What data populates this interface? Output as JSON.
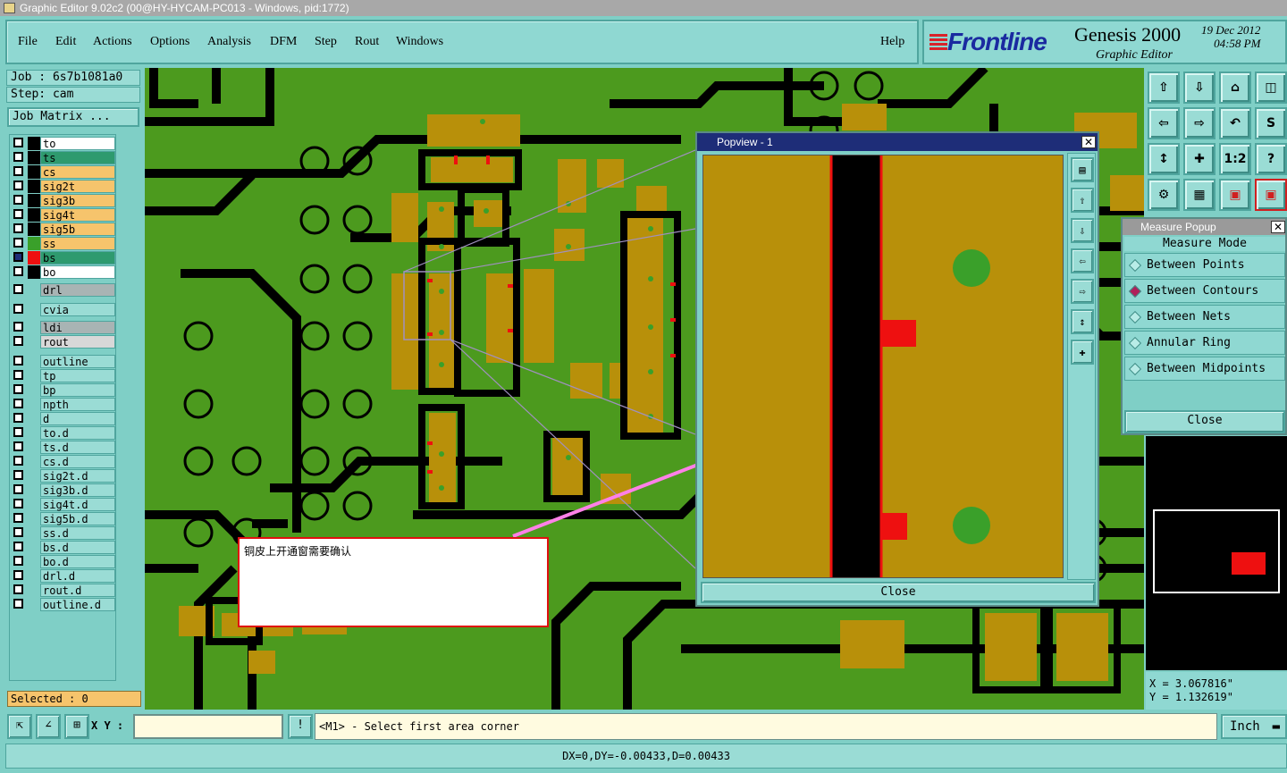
{
  "window": {
    "title": "Graphic Editor 9.02c2 (00@HY-HYCAM-PC013 - Windows, pid:1772)"
  },
  "menu": {
    "items": [
      "File",
      "Edit",
      "Actions",
      "Options",
      "Analysis",
      "DFM",
      "Step",
      "Rout",
      "Windows"
    ],
    "help": "Help"
  },
  "brand": {
    "logo": "Frontline",
    "product": "Genesis 2000",
    "subtitle": "Graphic Editor",
    "date": "19 Dec 2012",
    "time": "04:58 PM"
  },
  "job": {
    "job_label": "Job : 6s7b1081a0",
    "step_label": "Step: cam",
    "matrix_button": "Job Matrix ..."
  },
  "layers": [
    {
      "name": "to",
      "color": "#ffffff",
      "mark": "✎",
      "swatch": "#000000"
    },
    {
      "name": "ts",
      "color": "#2e9a6e",
      "mark": "",
      "swatch": "#000000"
    },
    {
      "name": "cs",
      "color": "#f6c46c",
      "mark": "",
      "swatch": "#000000"
    },
    {
      "name": "sig2t",
      "color": "#f6c46c",
      "mark": "",
      "swatch": "#000000"
    },
    {
      "name": "sig3b",
      "color": "#f6c46c",
      "mark": "",
      "swatch": "#000000"
    },
    {
      "name": "sig4t",
      "color": "#f6c46c",
      "mark": "",
      "swatch": "#000000"
    },
    {
      "name": "sig5b",
      "color": "#f6c46c",
      "mark": "",
      "swatch": "#000000"
    },
    {
      "name": "ss",
      "color": "#f6c46c",
      "mark": "",
      "swatch": "#3aa02a"
    },
    {
      "name": "bs",
      "color": "#2e9a6e",
      "mark": "⊞",
      "swatch": "#ee1010"
    },
    {
      "name": "bo",
      "color": "#ffffff",
      "mark": "✎",
      "swatch": "#000000"
    },
    {
      "name": "drl",
      "color": "#a8b4b4",
      "mark": "",
      "swatch": "#7fcfc6"
    },
    {
      "name": "cvia",
      "color": "#9adcd5",
      "mark": "",
      "swatch": "#7fcfc6"
    },
    {
      "name": "ldi",
      "color": "#a8b4b4",
      "mark": "",
      "swatch": "#7fcfc6"
    },
    {
      "name": "rout",
      "color": "#d8d8d8",
      "mark": "",
      "swatch": "#7fcfc6"
    },
    {
      "name": "outline",
      "color": "#9adcd5",
      "mark": "",
      "swatch": "#7fcfc6"
    },
    {
      "name": "tp",
      "color": "#9adcd5",
      "mark": "",
      "swatch": "#7fcfc6"
    },
    {
      "name": "bp",
      "color": "#9adcd5",
      "mark": "",
      "swatch": "#7fcfc6"
    },
    {
      "name": "npth",
      "color": "#9adcd5",
      "mark": "",
      "swatch": "#7fcfc6"
    },
    {
      "name": "d",
      "color": "#9adcd5",
      "mark": "",
      "swatch": "#7fcfc6"
    },
    {
      "name": "to.d",
      "color": "#9adcd5",
      "mark": "✎",
      "swatch": "#7fcfc6"
    },
    {
      "name": "ts.d",
      "color": "#9adcd5",
      "mark": "",
      "swatch": "#7fcfc6"
    },
    {
      "name": "cs.d",
      "color": "#9adcd5",
      "mark": "",
      "swatch": "#7fcfc6"
    },
    {
      "name": "sig2t.d",
      "color": "#9adcd5",
      "mark": "",
      "swatch": "#7fcfc6"
    },
    {
      "name": "sig3b.d",
      "color": "#9adcd5",
      "mark": "",
      "swatch": "#7fcfc6"
    },
    {
      "name": "sig4t.d",
      "color": "#9adcd5",
      "mark": "",
      "swatch": "#7fcfc6"
    },
    {
      "name": "sig5b.d",
      "color": "#9adcd5",
      "mark": "",
      "swatch": "#7fcfc6"
    },
    {
      "name": "ss.d",
      "color": "#9adcd5",
      "mark": "",
      "swatch": "#7fcfc6"
    },
    {
      "name": "bs.d",
      "color": "#9adcd5",
      "mark": "",
      "swatch": "#7fcfc6"
    },
    {
      "name": "bo.d",
      "color": "#9adcd5",
      "mark": "✎",
      "swatch": "#7fcfc6"
    },
    {
      "name": "drl.d",
      "color": "#9adcd5",
      "mark": "",
      "swatch": "#7fcfc6"
    },
    {
      "name": "rout.d",
      "color": "#9adcd5",
      "mark": "",
      "swatch": "#7fcfc6"
    },
    {
      "name": "outline.d",
      "color": "#9adcd5",
      "mark": "",
      "swatch": "#7fcfc6"
    }
  ],
  "selected": "Selected : 0",
  "toolbar": {
    "icons": [
      "home-up-icon",
      "home-down-icon",
      "home-icon",
      "panel-icon",
      "move-left-icon",
      "move-right-icon",
      "rotate-icon",
      "s-curve-icon",
      "fit-vertical-icon",
      "center-icon",
      "scale-1-2-icon",
      "help-icon",
      "tools-icon",
      "grid-icon",
      "network-icon",
      "network-active-icon"
    ],
    "scale_label": "1:2",
    "help_label": "?"
  },
  "popview": {
    "title": "Popview - 1",
    "close": "Close",
    "tool_icons": [
      "zoom-window-icon",
      "zoom-up-icon",
      "zoom-down-icon",
      "zoom-left-icon",
      "zoom-right-icon",
      "zoom-fit-icon",
      "zoom-center-icon"
    ]
  },
  "measure": {
    "title": "Measure Popup",
    "mode_label": "Measure Mode",
    "options": [
      {
        "label": "Between Points",
        "selected": false
      },
      {
        "label": "Between Contours",
        "selected": true
      },
      {
        "label": "Between Nets",
        "selected": false
      },
      {
        "label": "Annular Ring",
        "selected": false
      },
      {
        "label": "Between Midpoints",
        "selected": false
      }
    ],
    "close": "Close"
  },
  "coords": {
    "x": "X = 3.067816\"",
    "y": "Y = 1.132619\""
  },
  "bottom": {
    "xy_label": "X Y :",
    "xy_value": "",
    "prompt": "<M1> - Select first area corner",
    "units": "Inch"
  },
  "status": "DX=0,DY=-0.00433,D=0.00433",
  "annotation": {
    "text": "铜皮上开通窗需要确认"
  },
  "colors": {
    "board_green": "#4c9a1e",
    "pad_gold": "#b8900a",
    "highlight_red": "#ee1010",
    "arrow_pink": "#ff80e8"
  }
}
